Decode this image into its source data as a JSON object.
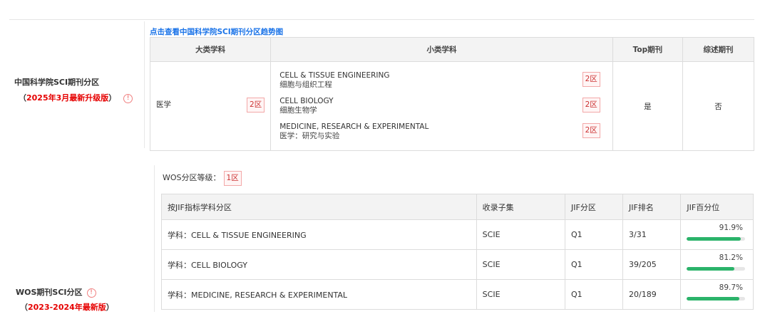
{
  "cas": {
    "title": "中国科学院SCI期刊分区",
    "subtitle_open": "（",
    "subtitle": "2025年3月最新升级版",
    "subtitle_close": "）",
    "trend_link": "点击查看中国科学院SCI期刊分区趋势图",
    "headers": [
      "大类学科",
      "小类学科",
      "Top期刊",
      "综述期刊"
    ],
    "major": {
      "name": "医学",
      "zone": "2区"
    },
    "subcategories": [
      {
        "en": "CELL & TISSUE ENGINEERING",
        "cn": "细胞与组织工程",
        "zone": "2区"
      },
      {
        "en": "CELL BIOLOGY",
        "cn": "细胞生物学",
        "zone": "2区"
      },
      {
        "en": "MEDICINE, RESEARCH & EXPERIMENTAL",
        "cn": "医学：研究与实验",
        "zone": "2区"
      }
    ],
    "top": "是",
    "review": "否"
  },
  "wos": {
    "title": "WOS期刊SCI分区",
    "subtitle_open": "（",
    "subtitle": "2023-2024年最新版",
    "subtitle_close": "）",
    "grade_label": "WOS分区等级：",
    "grade": "1区",
    "headers": [
      "按JIF指标学科分区",
      "收录子集",
      "JIF分区",
      "JIF排名",
      "JIF百分位"
    ],
    "rows": [
      {
        "category": "学科：CELL & TISSUE ENGINEERING",
        "collection": "SCIE",
        "quartile": "Q1",
        "rank": "3/31",
        "percentile": "91.9%",
        "percentile_value": 91.9
      },
      {
        "category": "学科：CELL BIOLOGY",
        "collection": "SCIE",
        "quartile": "Q1",
        "rank": "39/205",
        "percentile": "81.2%",
        "percentile_value": 81.2
      },
      {
        "category": "学科：MEDICINE, RESEARCH & EXPERIMENTAL",
        "collection": "SCIE",
        "quartile": "Q1",
        "rank": "20/189",
        "percentile": "89.7%",
        "percentile_value": 89.7
      }
    ]
  },
  "colors": {
    "accent_red": "#e60000",
    "link_blue": "#1a73e8",
    "bar_green": "#2bb36a"
  },
  "icons": {
    "info": "info-circle-icon"
  }
}
